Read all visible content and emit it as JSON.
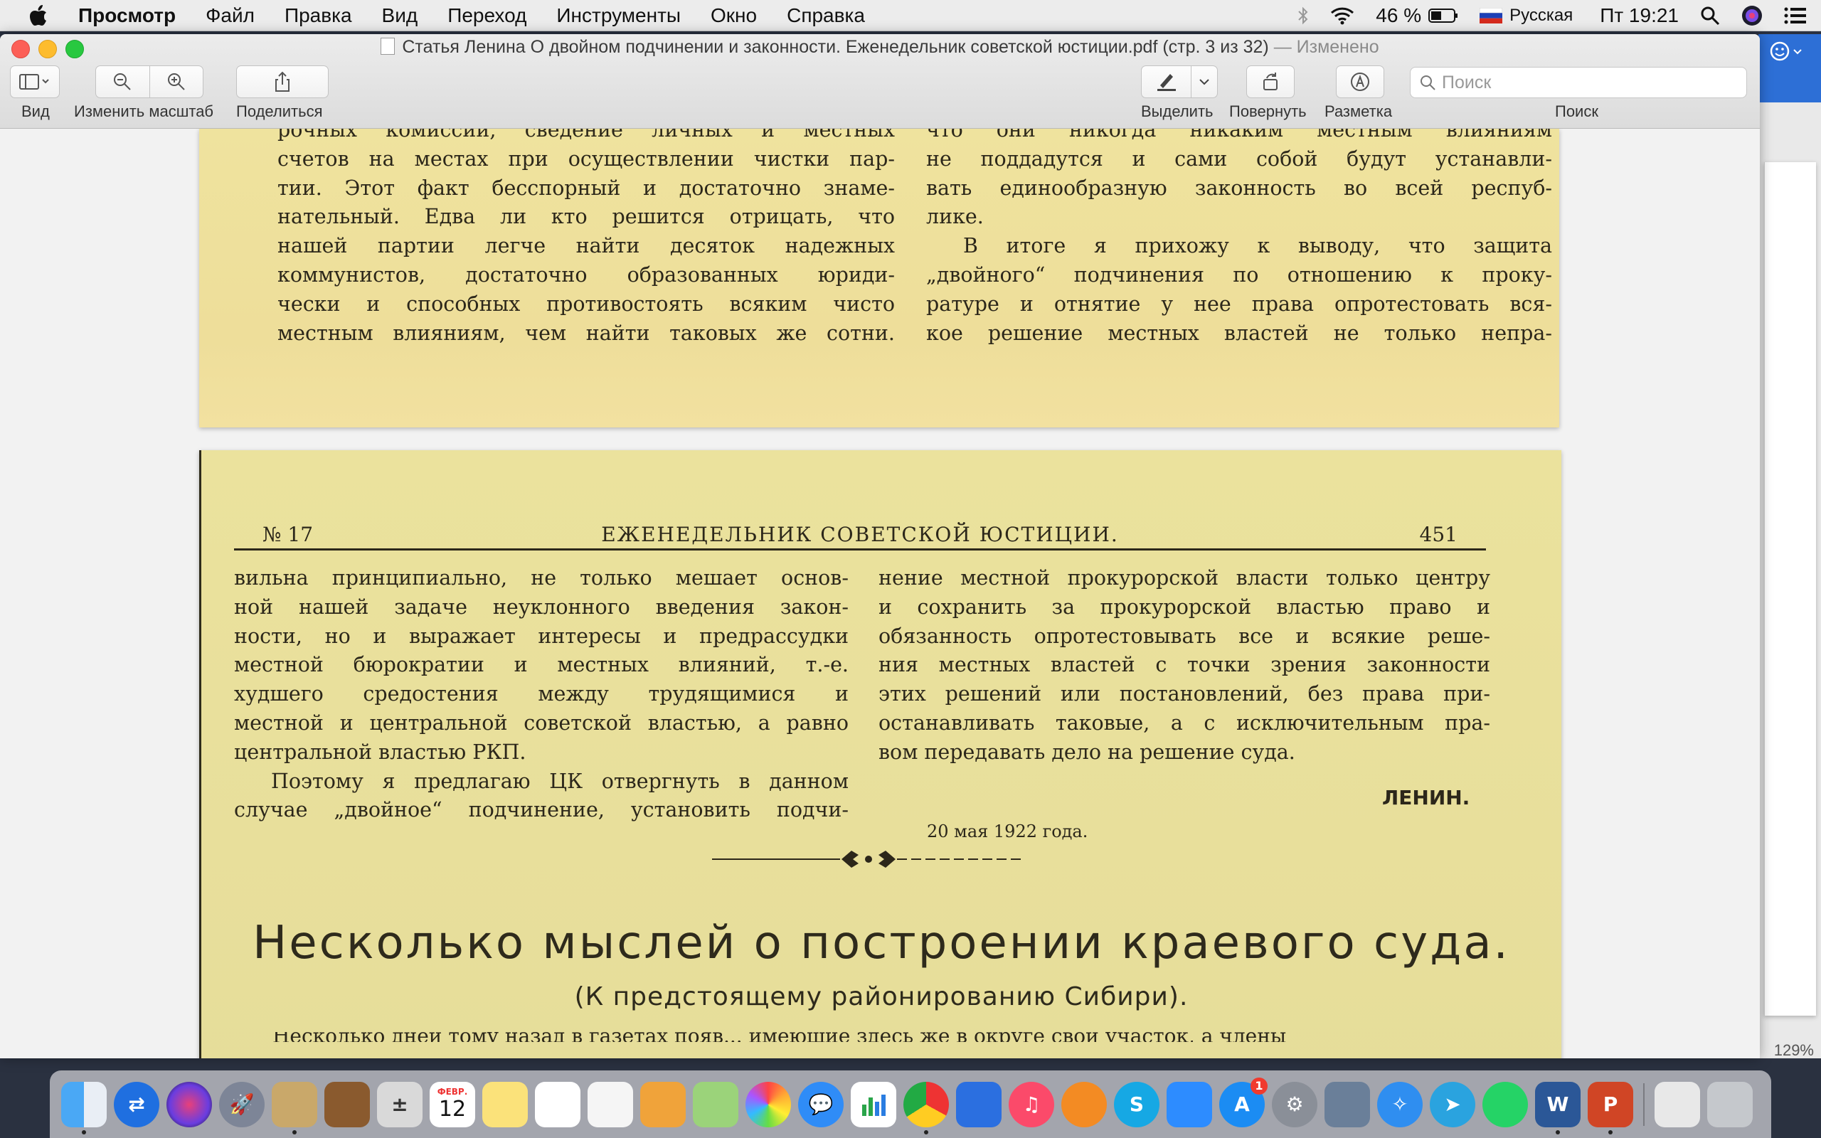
{
  "menubar": {
    "items": [
      "Просмотр",
      "Файл",
      "Правка",
      "Вид",
      "Переход",
      "Инструменты",
      "Окно",
      "Справка"
    ],
    "battery": "46 %",
    "input_source": "Русская",
    "clock": "Пт 19:21"
  },
  "window": {
    "title": "Статья Ленина О двойном подчинении и законности. Еженедельник советской юстиции.pdf (стр. 3 из 32)",
    "edited": "— Изменено"
  },
  "toolbar": {
    "view_label": "Вид",
    "zoom_label": "Изменить масштаб",
    "share_label": "Поделиться",
    "highlight_label": "Выделить",
    "rotate_label": "Повернуть",
    "markup_label": "Разметка",
    "search_placeholder": "Поиск",
    "search_label": "Поиск"
  },
  "page1": {
    "left_col": [
      "рочных комиссий, сведение личных и местных",
      "счетов на местах при осуществлении чистки пар-",
      "тии. Этот факт бесспорный и достаточно знаме-",
      "нательный. Едва ли кто решится отрицать, что",
      "нашей партии легче найти десяток надежных",
      "коммунистов, достаточно образованных юриди-",
      "чески и способных противостоять всяким чисто",
      "местным влияниям, чем найти таковых же сотни."
    ],
    "right_col": [
      "что они никогда никаким местным влияниям",
      "не поддадутся и сами собой будут устанавли-",
      "вать единообразную законность во всей респуб-",
      "лике.",
      "В итоге я прихожу к выводу, что защита",
      "„двойного“ подчинения по отношению к проку-",
      "ратуре и отнятие у нее права опротестовать вся-",
      "кое решение местных властей не только непра-"
    ]
  },
  "page2": {
    "issue": "№ 17",
    "journal": "ЕЖЕНЕДЕЛЬНИК СОВЕТСКОЙ ЮСТИЦИИ.",
    "page_number": "451",
    "left_col": [
      "вильна принципиально, не только мешает основ-",
      "ной нашей задаче неуклонного введения закон-",
      "ности, но и выражает интересы и предрассудки",
      "местной бюрократии и местных влияний, т.-е.",
      "худшего средостения между трудящимися и",
      "местной и центральной советской властью, а равно",
      "центральной властью РКП.",
      "Поэтому я предлагаю ЦК отвергнуть в данном",
      "случае „двойное“ подчинение, установить подчи-"
    ],
    "right_col": [
      "нение местной прокурорской власти только центру",
      "и сохранить за прокурорской властью право и",
      "обязанность опротестовывать все и всякие реше-",
      "ния местных властей с точки зрения законности",
      "этих решений или постановлений, без права при-",
      "останавливать таковые, а с исключительным пра-",
      "вом передавать дело на решение суда."
    ],
    "signature": "ЛЕНИН.",
    "date": "20 мая 1922 года.",
    "article_title": "Несколько мыслей о построении краевого суда.",
    "article_subtitle": "(К предстоящему районированию Сибири).",
    "cut_line": "Несколько дней тому назад в газетах появ... имеющие здесь же в округе свой участок, а члены"
  },
  "zoom_indicator": "129%",
  "dock": {
    "calendar_month": "ФЕВР.",
    "calendar_day": "12",
    "appstore_badge": "1"
  },
  "colors": {
    "page_paper": "#ede0a3",
    "text_ink": "#2c271a"
  }
}
